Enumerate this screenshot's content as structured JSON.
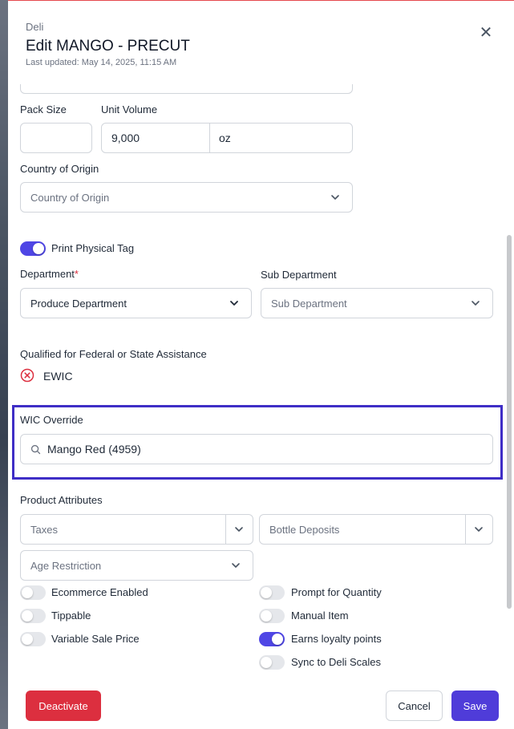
{
  "modal": {
    "breadcrumb": "Deli",
    "title": "Edit MANGO - PRECUT",
    "last_updated": "Last updated: May 14, 2025, 11:15 AM",
    "close_glyph": "✕"
  },
  "form": {
    "pack_size": {
      "label": "Pack Size",
      "value": ""
    },
    "unit_volume": {
      "label": "Unit Volume",
      "value": "9,000",
      "unit": "oz"
    },
    "country_of_origin": {
      "label": "Country of Origin",
      "placeholder": "Country of Origin"
    },
    "print_physical_tag": {
      "label": "Print Physical Tag",
      "on": true
    },
    "department": {
      "label": "Department",
      "required_mark": "*",
      "value": "Produce Department"
    },
    "sub_department": {
      "label": "Sub Department",
      "placeholder": "Sub Department"
    },
    "assistance": {
      "label": "Qualified for Federal or State Assistance",
      "item": "EWIC",
      "item_status": "not-qualified"
    },
    "wic_override": {
      "label": "WIC Override",
      "value": "Mango Red (4959)"
    },
    "product_attributes": {
      "label": "Product Attributes",
      "taxes_placeholder": "Taxes",
      "bottle_deposits_placeholder": "Bottle Deposits",
      "age_restriction_placeholder": "Age Restriction"
    },
    "toggles_left": [
      {
        "label": "Ecommerce Enabled",
        "on": false
      },
      {
        "label": "Tippable",
        "on": false
      },
      {
        "label": "Variable Sale Price",
        "on": false
      }
    ],
    "toggles_right": [
      {
        "label": "Prompt for Quantity",
        "on": false
      },
      {
        "label": "Manual Item",
        "on": false
      },
      {
        "label": "Earns loyalty points",
        "on": true
      },
      {
        "label": "Sync to Deli Scales",
        "on": false
      }
    ]
  },
  "footer": {
    "deactivate_label": "Deactivate",
    "cancel_label": "Cancel",
    "save_label": "Save"
  },
  "colors": {
    "accent": "#4f46e5",
    "danger": "#dc2f3f",
    "highlight_border": "#3f2ec6"
  }
}
